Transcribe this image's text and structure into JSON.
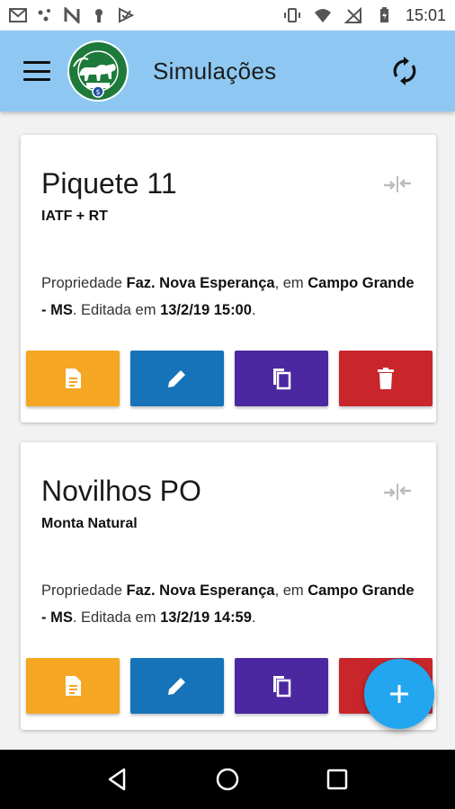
{
  "status_bar": {
    "time": "15:01",
    "left_icons": [
      "gmail-icon",
      "dots-icon",
      "n-icon",
      "keyhole-icon",
      "checklist-icon"
    ],
    "right_icons": [
      "vibrate-icon",
      "wifi-icon",
      "no-signal-icon",
      "battery-charging-icon"
    ]
  },
  "app_bar": {
    "title": "Simulações",
    "background": "#8ec8f2",
    "menu_icon": "hamburger-menu-icon",
    "logo": "farm-cattle-logo",
    "sync_icon": "sync-icon"
  },
  "cards": [
    {
      "title": "Piquete 11",
      "subtitle": "IATF + RT",
      "desc_prefix": "Propriedade ",
      "property": "Faz. Nova Esperança",
      "desc_mid": ", em ",
      "location": "Campo Grande - MS",
      "desc_edit": ". Editada em ",
      "edited": "13/2/19 15:00",
      "desc_end": "."
    },
    {
      "title": "Novilhos PO",
      "subtitle": "Monta Natural",
      "desc_prefix": "Propriedade ",
      "property": "Faz. Nova Esperança",
      "desc_mid": ", em ",
      "location": "Campo Grande - MS",
      "desc_edit": ". Editada em ",
      "edited": "13/2/19 14:59",
      "desc_end": "."
    }
  ],
  "actions": {
    "report": {
      "icon": "document-icon",
      "color": "#f5a623"
    },
    "edit": {
      "icon": "pencil-icon",
      "color": "#1673ba"
    },
    "copy": {
      "icon": "copy-icon",
      "color": "#4b28a0"
    },
    "delete": {
      "icon": "trash-icon",
      "color": "#c8262b"
    }
  },
  "fab": {
    "icon": "plus-icon",
    "color": "#23a6f0"
  },
  "nav_bar": {
    "buttons": [
      "back-icon",
      "home-icon",
      "recents-icon"
    ]
  }
}
